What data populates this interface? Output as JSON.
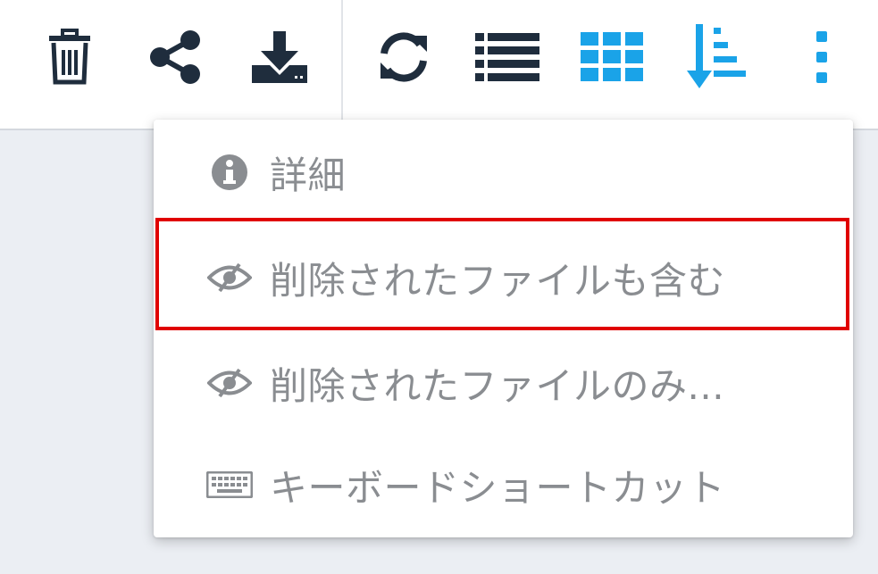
{
  "toolbar": {
    "buttons": [
      {
        "name": "delete-button",
        "icon": "trash-icon"
      },
      {
        "name": "share-button",
        "icon": "share-icon"
      },
      {
        "name": "download-button",
        "icon": "download-icon"
      },
      {
        "name": "refresh-button",
        "icon": "refresh-icon"
      },
      {
        "name": "list-view-button",
        "icon": "list-icon"
      },
      {
        "name": "grid-view-button",
        "icon": "grid-icon"
      },
      {
        "name": "sort-button",
        "icon": "sort-icon"
      },
      {
        "name": "more-menu-button",
        "icon": "kebab-icon"
      }
    ],
    "icon_color_dark": "#1f2d3d",
    "icon_color_accent": "#1aa3e8"
  },
  "menu": {
    "items": [
      {
        "label": "詳細",
        "icon": "info-icon"
      },
      {
        "label": "削除されたファイルも含む",
        "icon": "eye-slash-icon",
        "highlighted": true
      },
      {
        "label": "削除されたファイルのみ...",
        "icon": "eye-slash-icon"
      },
      {
        "label": "キーボードショートカット",
        "icon": "keyboard-icon"
      }
    ],
    "text_color": "#8a8d91",
    "highlight_color": "#e00000"
  }
}
